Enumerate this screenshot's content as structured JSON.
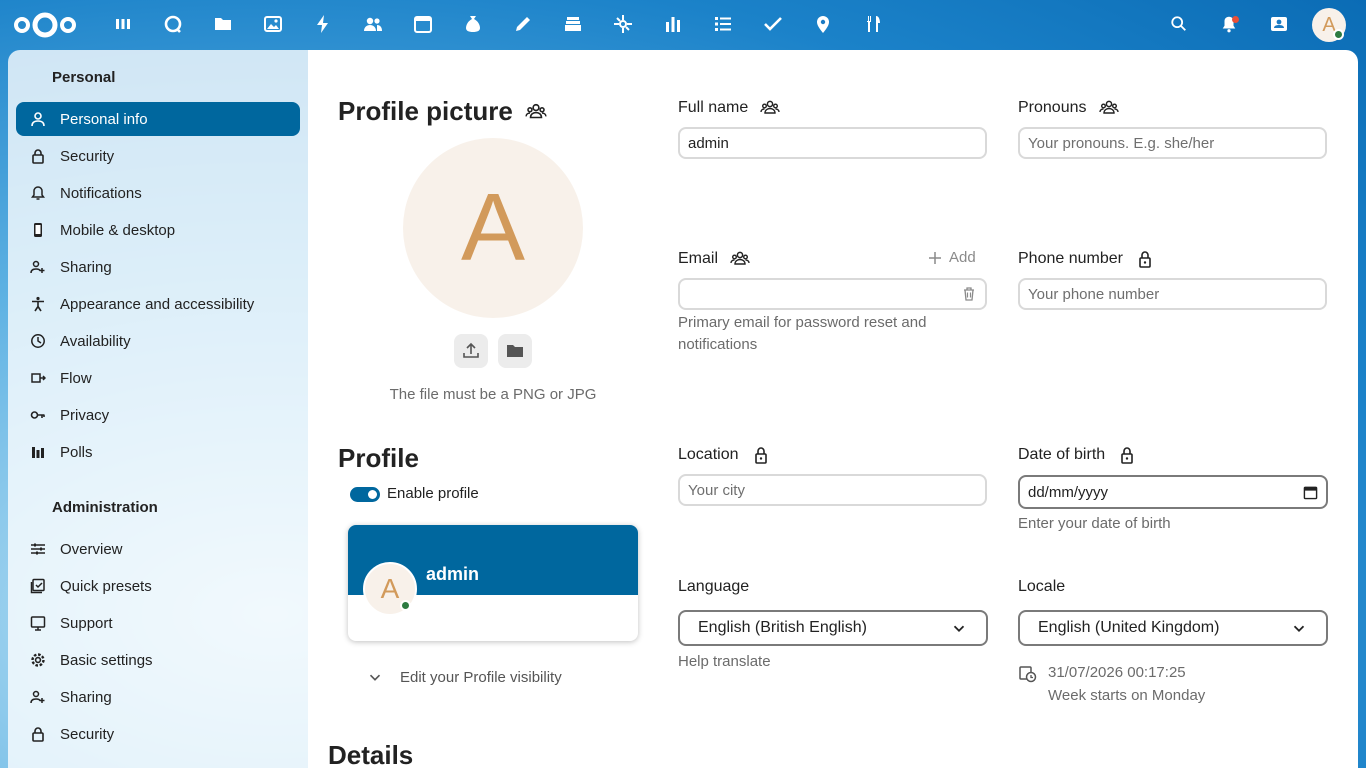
{
  "header": {
    "apps": [
      "dashboard-icon",
      "talk-icon",
      "files-icon",
      "photos-icon",
      "activity-icon",
      "contacts-icon",
      "calendar-icon",
      "cospend-icon",
      "notes-icon",
      "deck-icon",
      "tables-icon",
      "analytics-icon",
      "tasks-icon",
      "checklist-icon",
      "maps-icon",
      "cookbook-icon"
    ],
    "avatar_letter": "A"
  },
  "sidebar": {
    "personal_heading": "Personal",
    "personal_items": [
      {
        "label": "Personal info",
        "icon": "user-icon"
      },
      {
        "label": "Security",
        "icon": "lock-icon"
      },
      {
        "label": "Notifications",
        "icon": "bell-icon"
      },
      {
        "label": "Mobile & desktop",
        "icon": "phone-icon"
      },
      {
        "label": "Sharing",
        "icon": "share-icon"
      },
      {
        "label": "Appearance and accessibility",
        "icon": "accessibility-icon"
      },
      {
        "label": "Availability",
        "icon": "clock-icon"
      },
      {
        "label": "Flow",
        "icon": "flow-icon"
      },
      {
        "label": "Privacy",
        "icon": "key-icon"
      },
      {
        "label": "Polls",
        "icon": "polls-icon"
      }
    ],
    "admin_heading": "Administration",
    "admin_items": [
      {
        "label": "Overview",
        "icon": "sliders-icon"
      },
      {
        "label": "Quick presets",
        "icon": "presets-icon"
      },
      {
        "label": "Support",
        "icon": "support-icon"
      },
      {
        "label": "Basic settings",
        "icon": "gear-icon"
      },
      {
        "label": "Sharing",
        "icon": "share-icon"
      },
      {
        "label": "Security",
        "icon": "lock-icon"
      }
    ]
  },
  "profile_picture": {
    "title": "Profile picture",
    "avatar_letter": "A",
    "hint": "The file must be a PNG or JPG"
  },
  "profile": {
    "title": "Profile",
    "enable_label": "Enable profile",
    "card_name": "admin",
    "card_avatar_letter": "A",
    "edit_visibility": "Edit your Profile visibility"
  },
  "details": {
    "title": "Details"
  },
  "fields": {
    "full_name": {
      "label": "Full name",
      "value": "admin"
    },
    "pronouns": {
      "label": "Pronouns",
      "placeholder": "Your pronouns. E.g. she/her"
    },
    "email": {
      "label": "Email",
      "add": "Add",
      "value": "",
      "hint": "Primary email for password reset and notifications"
    },
    "phone": {
      "label": "Phone number",
      "placeholder": "Your phone number"
    },
    "location": {
      "label": "Location",
      "placeholder": "Your city"
    },
    "dob": {
      "label": "Date of birth",
      "placeholder": "dd/mm/yyyy",
      "hint": "Enter your date of birth"
    },
    "language": {
      "label": "Language",
      "value": "English (British English)",
      "hint": "Help translate"
    },
    "locale": {
      "label": "Locale",
      "value": "English (United Kingdom)",
      "time": "31/07/2026 00:17:25",
      "week": "Week starts on Monday"
    }
  }
}
